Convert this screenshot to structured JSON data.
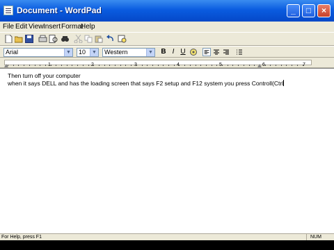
{
  "window": {
    "title": "Document - WordPad"
  },
  "menu": [
    "File",
    "Edit",
    "View",
    "Insert",
    "Format",
    "Help"
  ],
  "toolbar": {
    "icons": [
      "new-icon",
      "open-icon",
      "save-icon",
      "print-icon",
      "print-preview-icon",
      "find-icon",
      "cut-icon",
      "copy-icon",
      "paste-icon",
      "undo-icon",
      "insert-datetime-icon"
    ]
  },
  "format_bar": {
    "font": "Arial",
    "size": "10",
    "script": "Western",
    "bold": "B",
    "italic": "I",
    "underline": "U"
  },
  "ruler": {
    "marks": [
      "1",
      "2",
      "3",
      "4",
      "5",
      "6",
      "7"
    ]
  },
  "document": {
    "lines": [
      "Then turn off your computer",
      "when it says DELL and has the loading screen that says F2 setup and F12 system you press Controll(Ctrl"
    ]
  },
  "status": {
    "help": "For Help, press F1",
    "num": "NUM"
  },
  "colors": {
    "title_bar": "#0a5ce0",
    "chrome": "#ece9d8"
  }
}
